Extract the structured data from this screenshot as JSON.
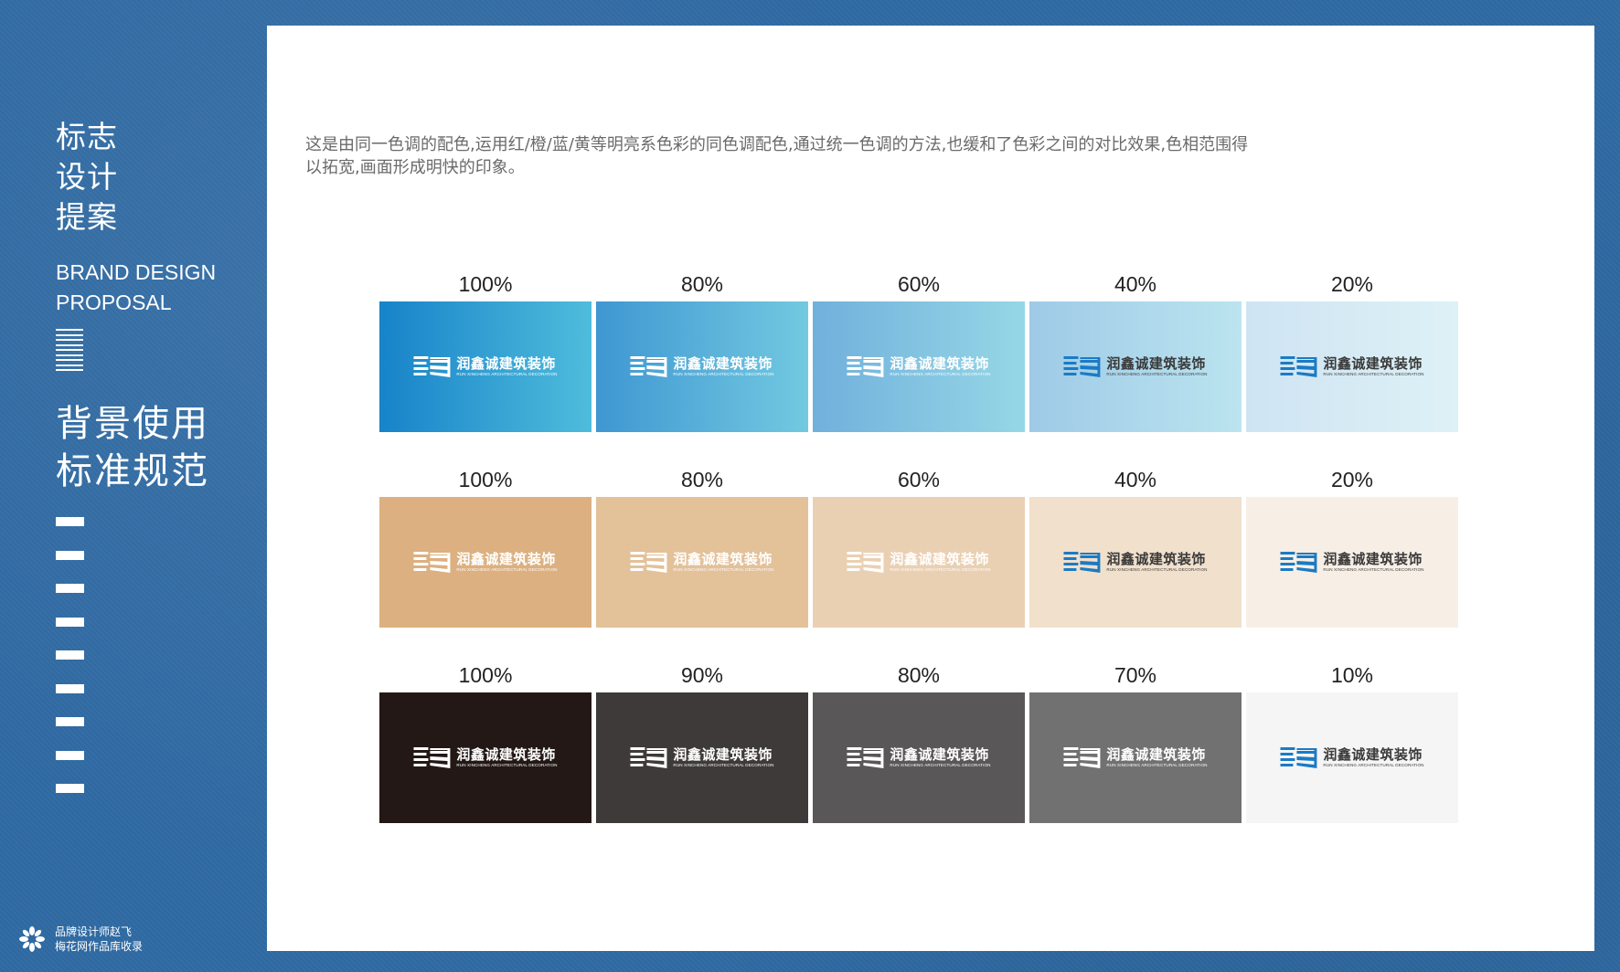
{
  "sidebar": {
    "title_cn": [
      "标志",
      "设计",
      "提案"
    ],
    "title_en": [
      "BRAND DESIGN",
      "PROPOSAL"
    ],
    "section_cn": [
      "背景使用",
      "标准规范"
    ],
    "footer": {
      "line1": "品牌设计师赵飞",
      "line2": "梅花网作品库收录"
    }
  },
  "main": {
    "description": "这是由同一色调的配色,运用红/橙/蓝/黄等明亮系色彩的同色调配色,通过统一色调的方法,也缓和了色彩之间的对比效果,色相范围得以拓宽,画面形成明快的印象。",
    "logo": {
      "name_cn": "润鑫诚建筑装饰",
      "name_en": "RUN XINCHENG ARCHITECTURAL DECORATION"
    },
    "rows": [
      {
        "name": "blue",
        "swatches": [
          {
            "label": "100%",
            "from": "#1783c9",
            "to": "#4fbcdc",
            "logo": "white"
          },
          {
            "label": "80%",
            "from": "#3f97d2",
            "to": "#72c9e0",
            "logo": "white"
          },
          {
            "label": "60%",
            "from": "#70b0dc",
            "to": "#96d7e6",
            "logo": "white"
          },
          {
            "label": "40%",
            "from": "#9fcae7",
            "to": "#bbe4ef",
            "logo": "color"
          },
          {
            "label": "20%",
            "from": "#cfe4f3",
            "to": "#ddf1f6",
            "logo": "color"
          }
        ]
      },
      {
        "name": "tan",
        "swatches": [
          {
            "label": "100%",
            "from": "#dcb080",
            "to": "#dcb080",
            "logo": "white"
          },
          {
            "label": "80%",
            "from": "#e3c199",
            "to": "#e3c199",
            "logo": "white"
          },
          {
            "label": "60%",
            "from": "#ead0b3",
            "to": "#ead0b3",
            "logo": "white"
          },
          {
            "label": "40%",
            "from": "#f1e0cc",
            "to": "#f1e0cc",
            "logo": "color"
          },
          {
            "label": "20%",
            "from": "#f7efe6",
            "to": "#f7efe6",
            "logo": "color"
          }
        ]
      },
      {
        "name": "gray",
        "swatches": [
          {
            "label": "100%",
            "from": "#231815",
            "to": "#231815",
            "logo": "white"
          },
          {
            "label": "90%",
            "from": "#3e3a39",
            "to": "#3e3a39",
            "logo": "white"
          },
          {
            "label": "80%",
            "from": "#595757",
            "to": "#595757",
            "logo": "white"
          },
          {
            "label": "70%",
            "from": "#727171",
            "to": "#727171",
            "logo": "white"
          },
          {
            "label": "10%",
            "from": "#f5f5f5",
            "to": "#f5f5f5",
            "logo": "color"
          }
        ]
      }
    ]
  },
  "colors": {
    "background": "#2f6aa3",
    "logo_blue": "#1b7bc4",
    "logo_dark": "#3a3a3a",
    "white": "#ffffff"
  },
  "icons": {
    "footer": "flower-icon",
    "logo_mark": "building-icon",
    "stack": "stacked-lines-icon"
  }
}
